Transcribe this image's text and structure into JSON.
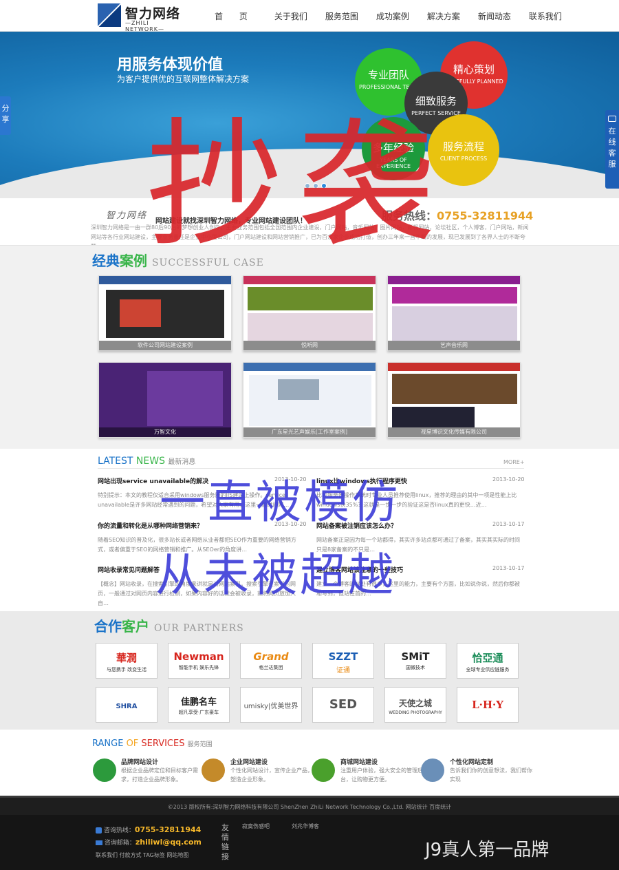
{
  "header": {
    "logo_cn": "智力网络",
    "logo_en": "—ZHILI NETWORK—",
    "nav": [
      "首 页",
      "关于我们",
      "服务范围",
      "成功案例",
      "解决方案",
      "新闻动态",
      "联系我们"
    ]
  },
  "side": {
    "share": "分享",
    "service": "在线客服"
  },
  "banner": {
    "headline": "用服务体现价值",
    "subline": "为客户提供优的互联网整体解决方案",
    "circles": [
      {
        "title": "专业团队",
        "en": "PROFESSIONAL TEAM",
        "color": "#2fc12f"
      },
      {
        "title": "精心策划",
        "en": "CAREFULLY PLANNED",
        "color": "#e0322f"
      },
      {
        "title": "细致服务",
        "en": "PERFECT SERVICE",
        "color": "#3a3a3a"
      },
      {
        "title": "多年经验",
        "en": "YEARS OF EXPERIENCE",
        "color": "#1d9a3c"
      },
      {
        "title": "服务流程",
        "en": "CLIENT PROCESS",
        "color": "#e9c30f"
      }
    ]
  },
  "intro": {
    "brand": "智力网络",
    "title": "网站建设就找深圳智力网络，专业网站建设团队！",
    "hotline_label": "服务热线：",
    "hotline": "0755-32811944",
    "text": "深圳智力网络是一由一群80后90后的梦想创业人创办。主要业务范围包括全国范围内企业建设，门户网站，音乐网站，图片网站，影视网站，论坛社区，个人博客，门户网站，新闻网站等各行业网站建设，主要业务量任是企业中小型公司，门户网站建设和网站营销推广，已为百余家企业成功打造，创办三年来一直不断的发展，现已发展到了各界人士的不断夸赞…"
  },
  "cases": {
    "title_a": "经典",
    "title_b": "案例",
    "title_en": "SUCCESSFUL CASE",
    "items": [
      {
        "caption": "软件公司网站建设案例",
        "color": "#2a2a2a"
      },
      {
        "caption": "悦听网",
        "color": "#c8325a"
      },
      {
        "caption": "艺声音乐网",
        "color": "#8a1f8f"
      },
      {
        "caption": "万智文化",
        "color": "#5a2a8a"
      },
      {
        "caption": "广东星光艺声娱乐[工作室案例]",
        "color": "#3d6fb0"
      },
      {
        "caption": "视星博识文化传媒有限公司",
        "color": "#c9302c"
      }
    ]
  },
  "news": {
    "title_a": "LATEST",
    "title_b": "NEWS",
    "title_cn": "最新消息",
    "more": "MORE+",
    "items": [
      {
        "title": "网站出现service unavailable的解决",
        "date": "2013-10-20",
        "body": "特别提示：本文的教程仅适合采用windows服务器的IIS建站上操作。service unavailable是许多网站经常遇到的问题，希望对大家有用，这里一般时间网…"
      },
      {
        "title": "linux比windows执行程序更快",
        "date": "2013-10-20",
        "body": "比较服务器操作系统时专业人员推荐使用linux，推荐的理由的其中一项是性能上比windows快35%？这就是一步一步的验证这是否linux真的更快…近…"
      },
      {
        "title": "你的流量和转化是从哪种网络营销来？",
        "date": "2013-10-20",
        "body": "随着SEO知识的普及化，很多站长或者网络从业者都把SEO作为重要的网络营销方式，或者偏重于SEO的网络营销和推广。从SEOer的角度讲…"
      },
      {
        "title": "网站备案被注销应该怎么办？",
        "date": "2013-10-17",
        "body": "网站备案正是因为每一个站都得，其实许多站点都可通过了备案，其实其实际的时间只是8家备案的不只是…"
      },
      {
        "title": "网站收录常见问题解答",
        "date": "2013-10-17",
        "body": "【概念】网站收录，在搜索引擎的角度来讲就是对网站索引，搜索引擎在索引的网页，一般通过对网页内容进行检测，如果内容好的话就会被收录，就将网页放加入自…"
      },
      {
        "title": "建立博客网站该注意的一些技巧",
        "date": "2013-10-17",
        "body": "建立一个博客的好处有很多，这里的能力，主要有个方面，比如说你说，然后你都被和写到，但站在首的…"
      }
    ]
  },
  "partners": {
    "title_a": "合作",
    "title_b": "客户",
    "title_en": "OUR PARTNERS",
    "logos": [
      {
        "name": "華潤",
        "sub": "与您携手 改变生活",
        "color": "#d7261e"
      },
      {
        "name": "Newman",
        "sub": "智能手机 娱乐先锋",
        "color": "#d7261e"
      },
      {
        "name": "Grand",
        "sub": "格兰达集团",
        "color": "#e98a13"
      },
      {
        "name": "SZZT",
        "sub": "证通",
        "color": "#1c5fb5"
      },
      {
        "name": "SMiT",
        "sub": "国微技术",
        "color": "#222222"
      },
      {
        "name": "恰亞通",
        "sub": "全球专业供应链服务",
        "color": "#1a8c58"
      },
      {
        "name": "SHRA",
        "sub": "",
        "color": "#1f4ea0"
      },
      {
        "name": "佳鹏名车",
        "sub": "超凡享受·广东豪车",
        "color": "#e98a13"
      },
      {
        "name": "umisky|优美世界",
        "sub": "",
        "color": "#555555"
      },
      {
        "name": "SED",
        "sub": "",
        "color": "#e07a15"
      },
      {
        "name": "天使之城",
        "sub": "WEDDING PHOTOGRAPHY",
        "color": "#555555"
      },
      {
        "name": "L·H·Y",
        "sub": "",
        "color": "#d7261e"
      }
    ]
  },
  "services": {
    "title_a": "RANGE",
    "title_b": "OF",
    "title_c": "SERVICES",
    "title_cn": "服务范围",
    "items": [
      {
        "title": "品牌网站设计",
        "text": "根据企业品牌定位和目标客户需求，打造企业品牌形象。",
        "color": "#2c9a3c"
      },
      {
        "title": "企业网站建设",
        "text": "个性化网站设计，宣传企业产品，塑造企业形象。",
        "color": "#c48a2a"
      },
      {
        "title": "商城网站建设",
        "text": "注重用户体验，强大安全的管理后台，让购物更方便。",
        "color": "#4aa02c"
      },
      {
        "title": "个性化网站定制",
        "text": "告诉我们你的创意想法，我们帮你实现",
        "color": "#6a8fb8"
      }
    ]
  },
  "footer": {
    "copyright": "©2013 版权所有:深圳智力网络科技有限公司 ShenZhen ZhiLi Network Technology Co.,Ltd. 网站统计 百度统计",
    "hotline_label": "咨询热线：",
    "hotline": "0755-32811944",
    "email_label": "咨询邮箱：",
    "email": "zhiliwl@qq.com",
    "links_label": "友情链接",
    "friend_links": [
      "寂寞伤感吧",
      "刘兆华博客"
    ],
    "bottom_links": "联系我们 付款方式 TAG标签 网站地图"
  },
  "overlays": {
    "big": "抄袭",
    "line1": "一直被模仿",
    "line2": "从未被超越",
    "watermark": "J9真人第一品牌"
  }
}
